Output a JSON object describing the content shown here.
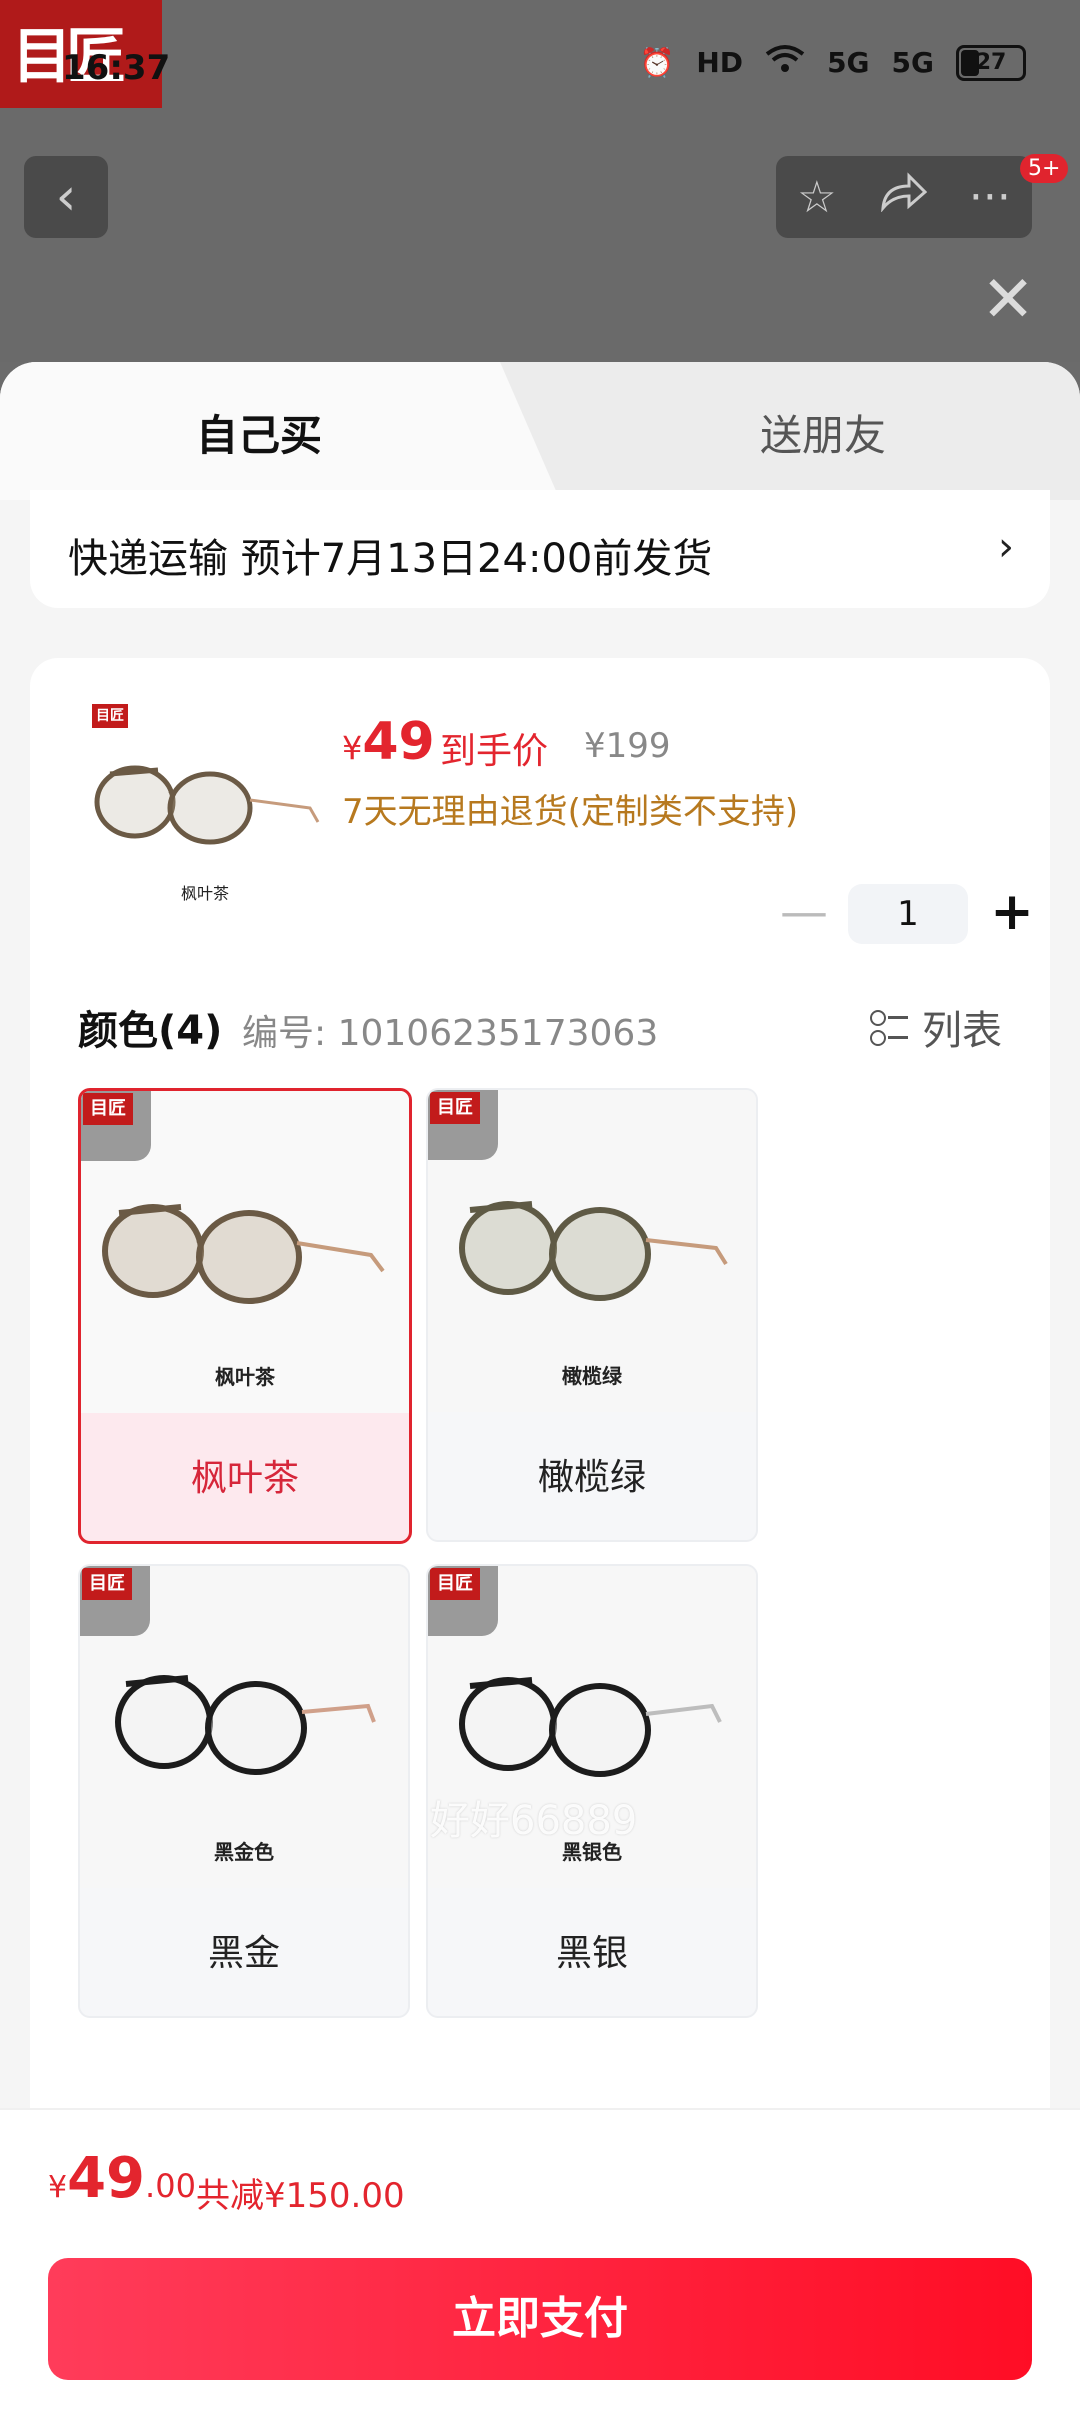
{
  "status_bar": {
    "time": "16:37",
    "hd_label": "HD",
    "net_1": "5G",
    "net_2": "5G",
    "battery": "27"
  },
  "nav": {
    "badge": "5+"
  },
  "tabs": [
    {
      "label": "自己买"
    },
    {
      "label": "送朋友"
    }
  ],
  "shipping": {
    "text": "快递运输 预计7月13日24:00前发货",
    "arrow": "›"
  },
  "product": {
    "thumb_caption": "枫叶茶",
    "currency": "¥",
    "price": "49",
    "price_tag": "到手价",
    "original_price": "¥199",
    "refund_policy": "7天无理由退货(定制类不支持)",
    "quantity": "1"
  },
  "colors": {
    "title": "颜色(4)",
    "code": "编号: 10106235173063",
    "list_label": "列表",
    "options": [
      {
        "caption": "枫叶茶",
        "name": "枫叶茶",
        "selected": true,
        "frame_color": "#6b5a45",
        "temple_color": "#c69b7c"
      },
      {
        "caption": "橄榄绿",
        "name": "橄榄绿",
        "selected": false,
        "frame_color": "#5f5a45",
        "temple_color": "#c69b7c"
      },
      {
        "caption": "黑金色",
        "name": "黑金",
        "selected": false,
        "frame_color": "#1c1c1c",
        "temple_color": "#d0a08a"
      },
      {
        "caption": "黑银色",
        "name": "黑银",
        "selected": false,
        "frame_color": "#1c1c1c",
        "temple_color": "#bdbdbd"
      }
    ]
  },
  "watermark": "好好66889",
  "bottom": {
    "currency": "¥",
    "total_int": "49",
    "total_dec": ".00",
    "discount": "共减¥150.00",
    "pay_label": "立即支付"
  },
  "colors_theme": {
    "accent": "#e3252e",
    "refund": "#b7791f"
  }
}
